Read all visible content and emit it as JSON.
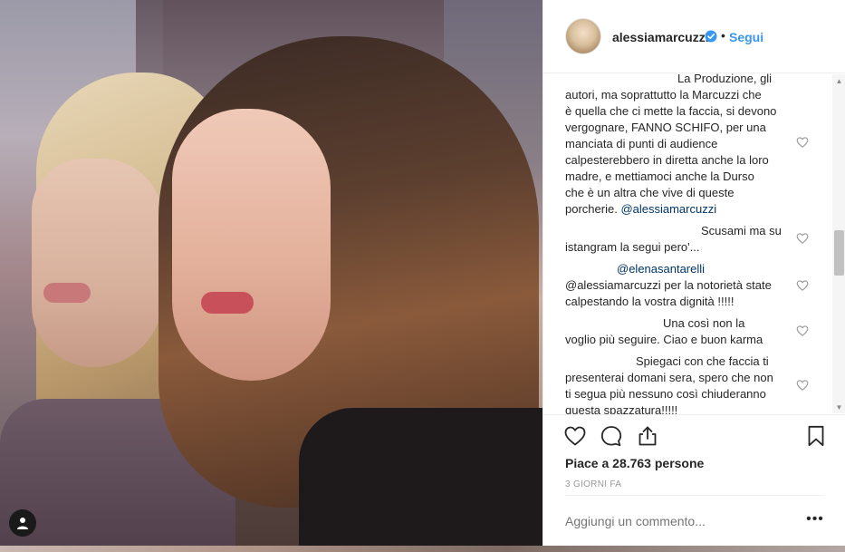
{
  "post": {
    "username": "alessiamarcuzzi",
    "follow_separator": "•",
    "follow_label": "Segui",
    "likes_text": "Piace a 28.763 persone",
    "time_text": "3 GIORNI FA",
    "add_comment_placeholder": "Aggiungi un commento...",
    "more_label": "•••"
  },
  "comments": [
    {
      "text_lines": [
        "La Produzione, gli",
        "autori, ma soprattutto la Marcuzzi che",
        "è quella che ci mette la faccia, si devono",
        "vergognare, FANNO SCHIFO, per una",
        "manciata di punti di audience",
        "calpesterebbero in diretta anche la loro",
        "madre, e mettiamoci anche la Durso",
        "che è un altra che vive di queste",
        "porcherie."
      ],
      "mention": "@alessiamarcuzzi"
    },
    {
      "text_lines": [
        "Scusami ma su",
        "istangram la segui pero'..."
      ]
    },
    {
      "mention_first": "@elenasantarelli",
      "text_lines": [
        "@alessiamarcuzzi per la notorietà state",
        "calpestando la vostra dignità !!!!!"
      ]
    },
    {
      "text_lines": [
        "Una così non la",
        "voglio più seguire. Ciao e buon karma"
      ]
    },
    {
      "text_lines": [
        "Spiegaci con che faccia ti",
        "presenterai domani sera, spero che non",
        "ti segua più nessuno così chiuderanno",
        "questa spazzatura!!!!!"
      ]
    }
  ],
  "icons": {
    "verified": "verified-badge-icon",
    "like": "heart-icon",
    "comment": "comment-bubble-icon",
    "share": "share-icon",
    "save": "bookmark-icon",
    "comment_like": "heart-outline-icon",
    "profile": "user-icon"
  },
  "colors": {
    "link_blue": "#3897f0",
    "mention_blue": "#003569",
    "text": "#262626",
    "muted": "#999999"
  }
}
